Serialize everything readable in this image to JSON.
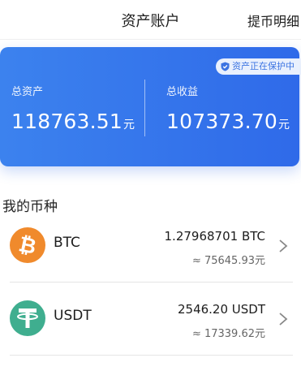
{
  "header": {
    "title": "资产账户",
    "right_link": "提币明细"
  },
  "asset_card": {
    "badge": "资产正在保护中",
    "total_assets_label": "总资产",
    "total_assets_value": "118763.51",
    "total_assets_unit": "元",
    "total_income_label": "总收益",
    "total_income_value": "107373.70",
    "total_income_unit": "元",
    "card_color": "#2f6ae9"
  },
  "section": {
    "title": "我的币种"
  },
  "coins": [
    {
      "symbol": "BTC",
      "icon": "bitcoin-icon",
      "icon_color": "#f08a2c",
      "amount": "1.27968701 BTC",
      "cny_value": "≈ 75645.93元"
    },
    {
      "symbol": "USDT",
      "icon": "tether-icon",
      "icon_color": "#3fae8f",
      "amount": "2546.20 USDT",
      "cny_value": "≈ 17339.62元"
    }
  ]
}
